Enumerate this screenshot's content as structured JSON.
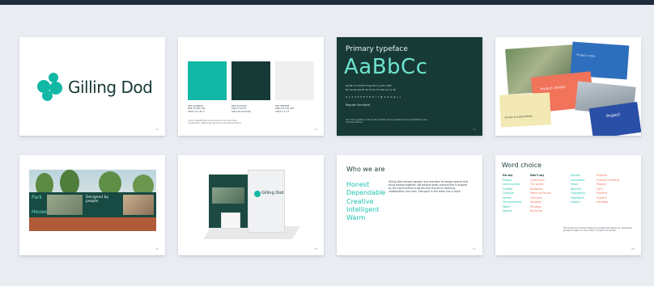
{
  "colors": {
    "teal": "#12b8a6",
    "dark_green": "#173a36",
    "light_grey": "#efefef",
    "word_green": "#1fc2b0",
    "word_coral": "#f0735a"
  },
  "slides": [
    {
      "id": "logo",
      "brand_name": "Gilling Dod",
      "page_number": "01"
    },
    {
      "id": "palette",
      "swatches": [
        {
          "name": "teal",
          "hex": "#12b8a6",
          "text": [
            "HEX #12B8A6",
            "RGB 18 184 166",
            "CMYK 75 0 45 0"
          ]
        },
        {
          "name": "dark",
          "hex": "#173a36",
          "text": [
            "HEX #173A36",
            "RGB 23 58 54",
            "CMYK 80 40 60 60"
          ]
        },
        {
          "name": "light",
          "hex": "#efefef",
          "text": [
            "HEX #EFEFEF",
            "RGB 239 239 239",
            "CMYK 5 3 3 0"
          ]
        }
      ],
      "note": "Colour palette text lorem ipsum dolor sit amet, consectetur adipiscing elit sed do eiusmod tempor.",
      "page_number": "02"
    },
    {
      "id": "typeface",
      "label": "Primary typeface",
      "specimen": "AaBbCc",
      "alphabet_upper": "Aa Bb Cc Dd Ee Ff Gg Hh Ii Jj Kk Ll Mm",
      "alphabet_lower": "Nn Oo Pp Qq Rr Ss Tt Uu Vv Ww Xx Yy Zz",
      "numerals": "0 1 2 3 4 5 6 7 8 9  ! ? @ £ $ % & ( )",
      "weight_label": "Regular Semibold",
      "note": "Our main typeface is the most versatile and is available across all platforms and communications.",
      "page_number": "03"
    },
    {
      "id": "collage",
      "card_labels": [
        "Project name",
        "Project design",
        "Access & sustainability",
        "Project"
      ],
      "page_number": "04"
    },
    {
      "id": "hoarding",
      "board_word_1": "Park",
      "board_word_2": "House",
      "board_tagline": "Designed by people",
      "page_number": "05"
    },
    {
      "id": "exhibition",
      "stand_brand": "Gilling Dod",
      "page_number": "06"
    },
    {
      "id": "who-we-are",
      "title": "Who we are",
      "words": [
        "Honest",
        "Dependable",
        "Creative",
        "Intelligent",
        "Warm"
      ],
      "body": "Gilling Dod merges passion and precision to design spaces that bring people together. We believe great architecture is shaped by the communities it serves and is built on listening, collaboration and care. Everyone in the team has a voice.",
      "page_number": "07"
    },
    {
      "id": "word-choice",
      "title": "Word choice",
      "col1_header": "Do say",
      "col1": [
        "People",
        "Communities",
        "Crafted",
        "Creative",
        "Voices",
        "Conversations",
        "Warm",
        "Spaces"
      ],
      "col2_header": "Don't say",
      "col2": [
        "Customers",
        "The public",
        "Designed",
        "State-of-the-art",
        "Opinions",
        "Updates",
        "Strategy",
        "Buildings"
      ],
      "col3": [
        "Homes",
        "Innovative",
        "Heart",
        "Warmth",
        "Thoughtful",
        "Intelligent",
        "Legacy"
      ],
      "col4": [
        "Projects",
        "Forward thinking",
        "Passion",
        "Care",
        "Practice",
        "Experts",
        "Heritage"
      ],
      "note": "The words we choose shape how people feel about us. Use these guides to keep our tone warm, honest and human.",
      "page_number": "08"
    }
  ]
}
